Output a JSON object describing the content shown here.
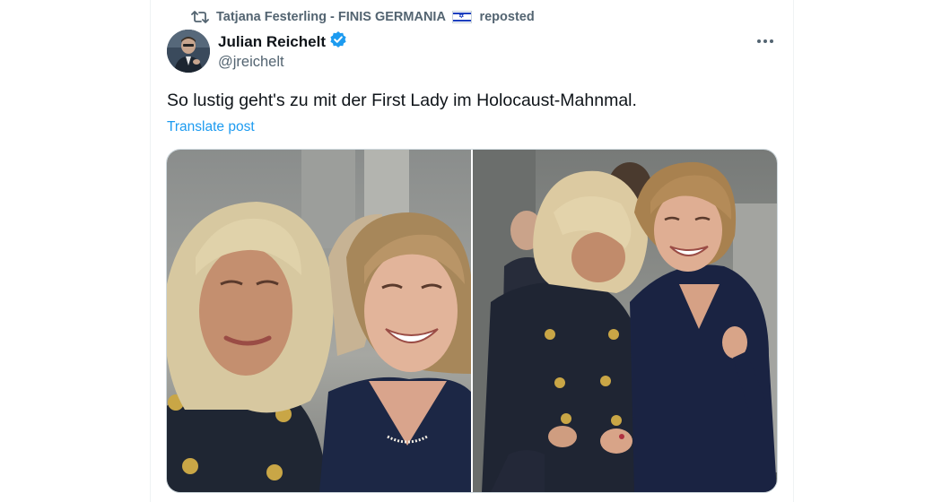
{
  "repost": {
    "user": "Tatjana Festerling - FINIS GERMANIA",
    "suffix": "reposted",
    "flag_icon": "israel-flag-icon"
  },
  "author": {
    "name": "Julian Reichelt",
    "handle": "@jreichelt",
    "verified": true,
    "verified_color": "#1d9bf0"
  },
  "post": {
    "text": "So lustig geht's zu mit der First Lady im Holocaust-Mahnmal.",
    "translate_label": "Translate post"
  },
  "media": {
    "count": 2
  },
  "colors": {
    "text": "#0f1419",
    "secondary": "#536471",
    "link": "#1d9bf0",
    "border": "#cfd9de"
  }
}
